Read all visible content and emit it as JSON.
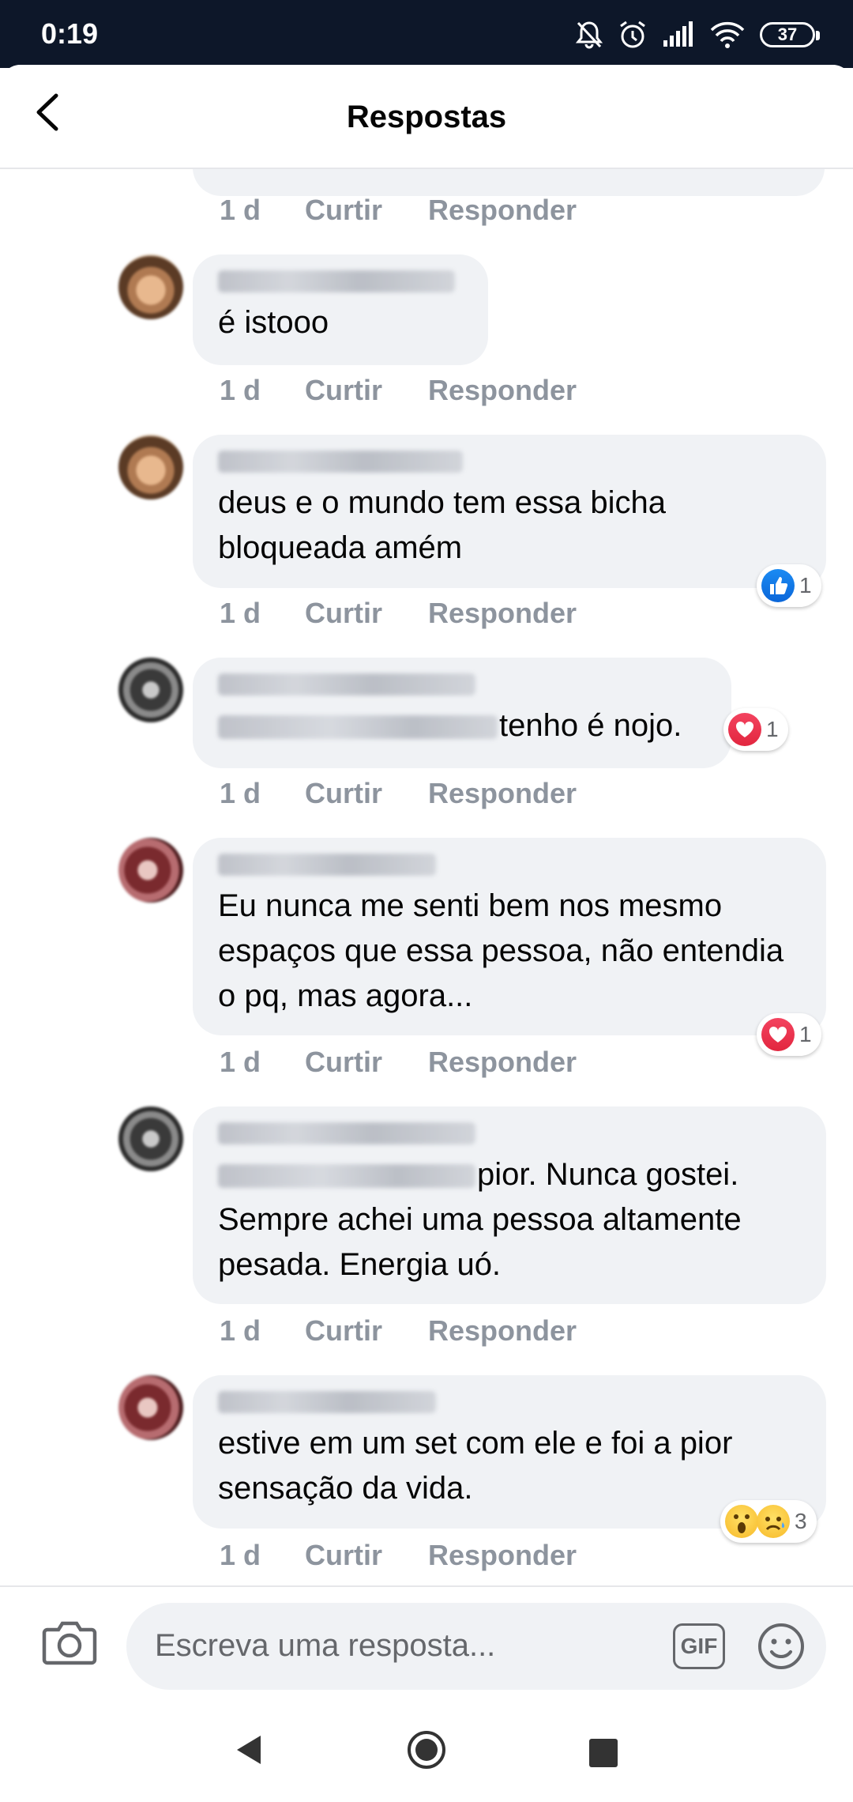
{
  "status_bar": {
    "time": "0:19",
    "battery": "37",
    "icons": [
      "bell-off-icon",
      "alarm-icon",
      "signal-icon",
      "wifi-icon",
      "battery-icon"
    ]
  },
  "header": {
    "title": "Respostas",
    "back_icon": "back-arrow-icon"
  },
  "top_meta": {
    "time": "1 d",
    "like": "Curtir",
    "reply": "Responder"
  },
  "comments": [
    {
      "author": "",
      "mention": "",
      "text": "é istooo",
      "time": "1 d",
      "like": "Curtir",
      "reply": "Responder",
      "reaction_count": ""
    },
    {
      "author": "",
      "mention": "",
      "text": "deus e o mundo tem essa bicha bloqueada amém",
      "time": "1 d",
      "like": "Curtir",
      "reply": "Responder",
      "reactions": [
        "like"
      ],
      "reaction_count": "1"
    },
    {
      "author": "",
      "mention": "",
      "text": "tenho é nojo.",
      "time": "1 d",
      "like": "Curtir",
      "reply": "Responder",
      "reactions": [
        "love"
      ],
      "reaction_count": "1"
    },
    {
      "author": "",
      "mention": "",
      "text": "Eu nunca me senti bem nos mesmo espaços que essa pessoa, não entendia o pq, mas agora...",
      "time": "1 d",
      "like": "Curtir",
      "reply": "Responder",
      "reactions": [
        "love"
      ],
      "reaction_count": "1"
    },
    {
      "author": "",
      "mention": "",
      "text_line1": "pior. Nunca gostei.",
      "text_rest": "Sempre achei uma pessoa altamente pesada. Energia uó.",
      "time": "1 d",
      "like": "Curtir",
      "reply": "Responder",
      "reaction_count": ""
    },
    {
      "author": "",
      "mention": "",
      "text": "estive em um set com ele e foi a pior sensação da vida.",
      "time": "1 d",
      "like": "Curtir",
      "reply": "Responder",
      "reactions": [
        "wow",
        "sad"
      ],
      "reaction_count": "3"
    }
  ],
  "composer": {
    "placeholder": "Escreva uma resposta...",
    "gif_label": "GIF",
    "camera_icon": "camera-icon",
    "emoji_icon": "emoji-icon"
  },
  "colors": {
    "status_bar_bg": "#0d1729",
    "bubble_bg": "#f0f2f5",
    "meta_text": "#8d949e",
    "like_blue": "#1877f2",
    "love_red": "#f33e58"
  }
}
